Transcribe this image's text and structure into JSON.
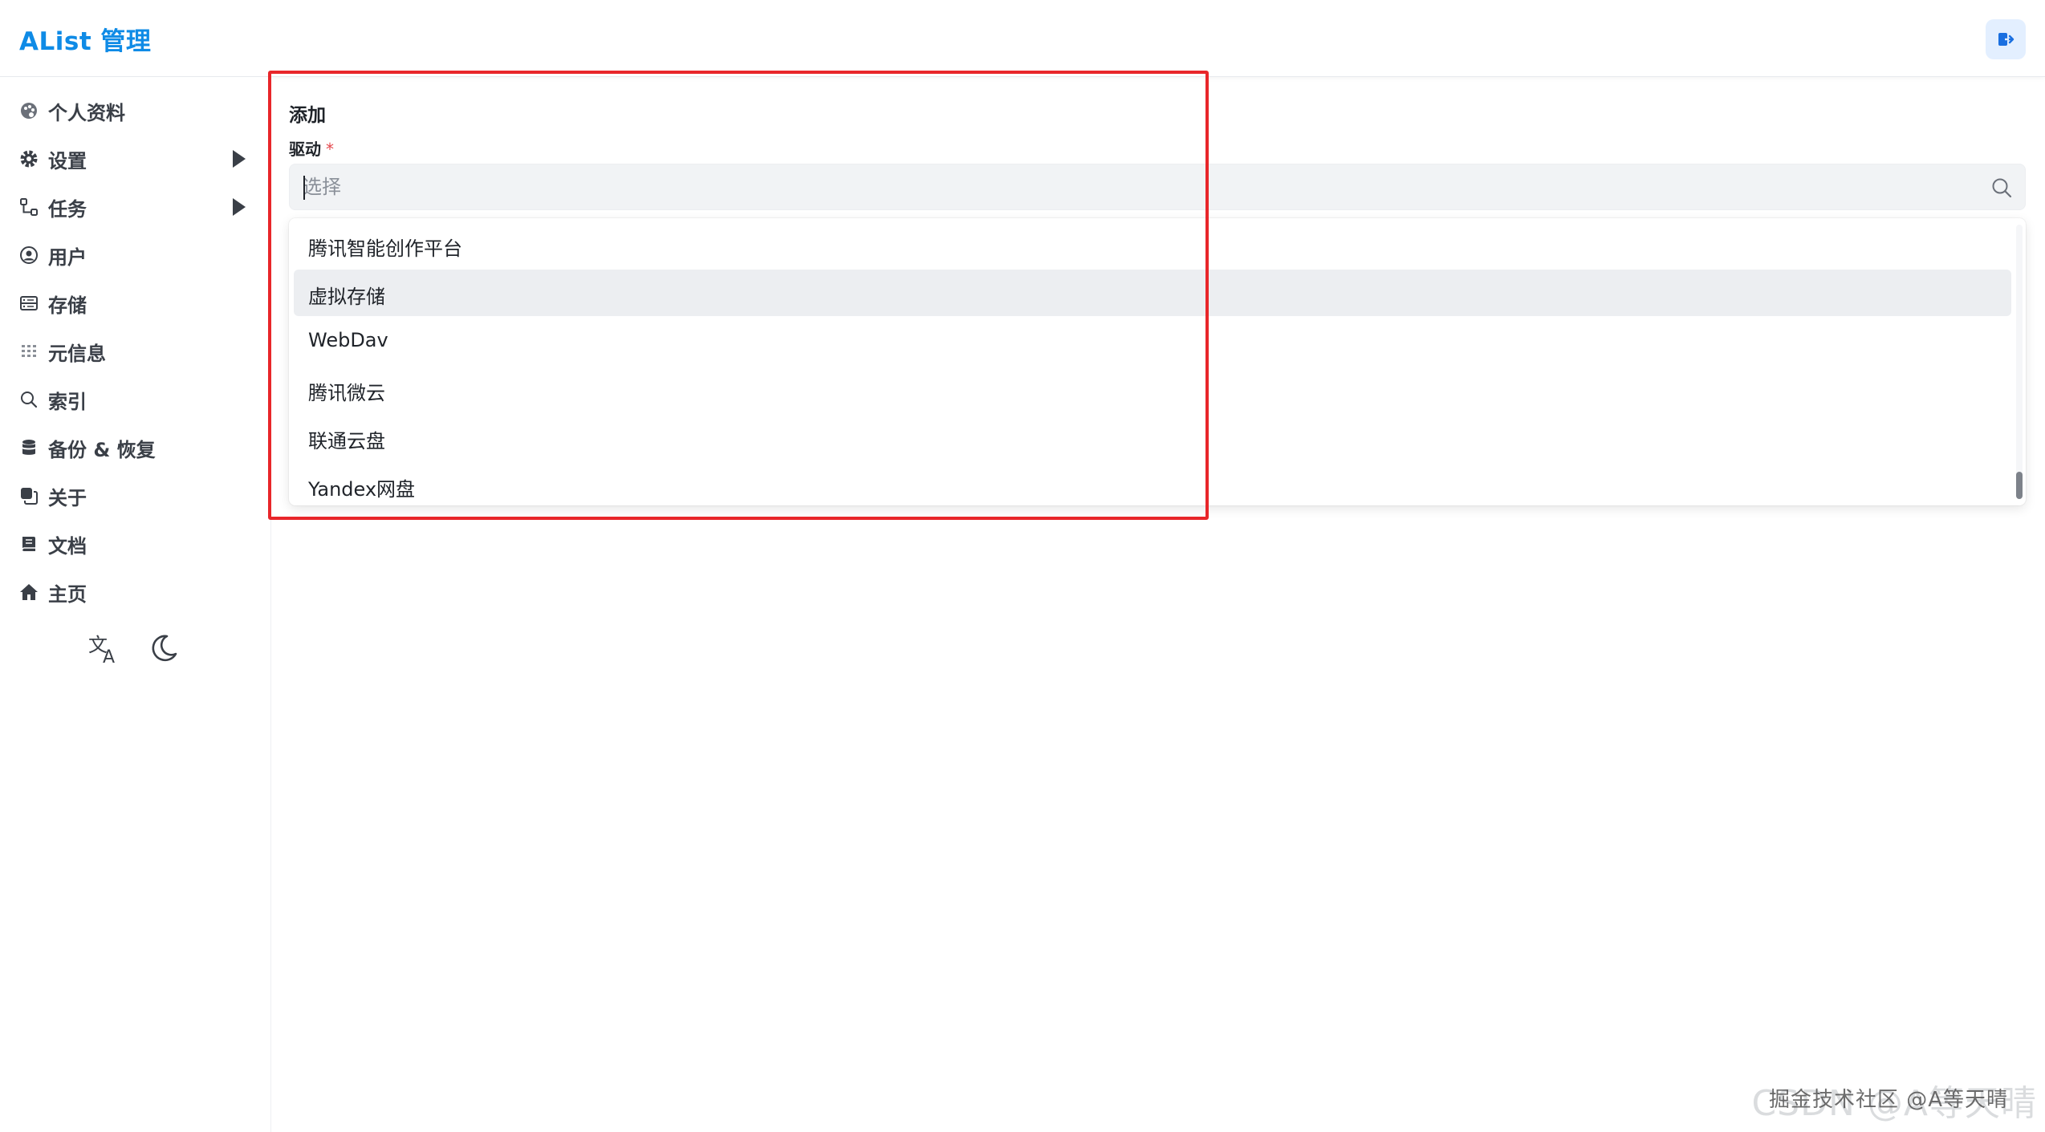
{
  "app": {
    "title": "AList 管理"
  },
  "header": {
    "logout_icon": "logout-icon"
  },
  "sidebar": {
    "items": [
      {
        "label": "个人资料",
        "icon": "palette-icon",
        "has_children": false
      },
      {
        "label": "设置",
        "icon": "gear-icon",
        "has_children": true
      },
      {
        "label": "任务",
        "icon": "flow-icon",
        "has_children": true
      },
      {
        "label": "用户",
        "icon": "user-circle-icon",
        "has_children": false
      },
      {
        "label": "存储",
        "icon": "storage-icon",
        "has_children": false
      },
      {
        "label": "元信息",
        "icon": "grid-icon",
        "has_children": false
      },
      {
        "label": "索引",
        "icon": "search-icon",
        "has_children": false
      },
      {
        "label": "备份 & 恢复",
        "icon": "database-icon",
        "has_children": false
      },
      {
        "label": "关于",
        "icon": "copy-icon",
        "has_children": false
      },
      {
        "label": "文档",
        "icon": "book-icon",
        "has_children": false
      },
      {
        "label": "主页",
        "icon": "home-icon",
        "has_children": false
      }
    ],
    "bottom_icons": [
      "translate-icon",
      "moon-icon"
    ]
  },
  "main": {
    "section_title": "添加",
    "field": {
      "label": "驱动",
      "required_mark": "*",
      "placeholder": "选择"
    },
    "options": [
      {
        "label": "腾讯智能创作平台",
        "active": false
      },
      {
        "label": "虚拟存储",
        "active": true
      },
      {
        "label": "WebDav",
        "active": false
      },
      {
        "label": "腾讯微云",
        "active": false
      },
      {
        "label": "联通云盘",
        "active": false
      },
      {
        "label": "Yandex网盘",
        "active": false
      }
    ]
  },
  "colors": {
    "brand": "#0f8be6",
    "highlight": "#e8262a",
    "required": "#e5484d"
  },
  "watermark": {
    "big": "CSDN @A等天晴",
    "small": "掘金技术社区 @A等天晴"
  }
}
